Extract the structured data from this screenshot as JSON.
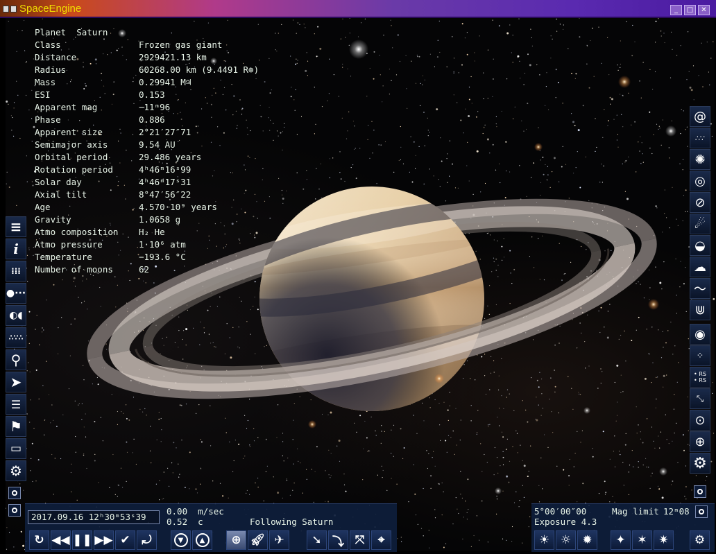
{
  "window": {
    "title": "SpaceEngine",
    "minimize_label": "_",
    "maximize_label": "□",
    "close_label": "✕"
  },
  "info": {
    "header_key": "Planet",
    "header_value": "Saturn",
    "rows": [
      {
        "key": "Class",
        "value": "Frozen gas giant"
      },
      {
        "key": "Distance",
        "value": "2929421.13 km"
      },
      {
        "key": "Radius",
        "value": "60268.00 km (9.4491 R⊕)"
      },
      {
        "key": "Mass",
        "value": "0.29941 M♃"
      },
      {
        "key": "ESI",
        "value": "0.153"
      },
      {
        "key": "Apparent mag",
        "value": "−11ᵐ96"
      },
      {
        "key": "Phase",
        "value": "0.886"
      },
      {
        "key": "Apparent size",
        "value": "2°21′27″71"
      },
      {
        "key": "Semimajor axis",
        "value": "9.54 AU"
      },
      {
        "key": "Orbital period",
        "value": "29.486 years"
      },
      {
        "key": "Rotation period",
        "value": "4ʰ46ᵐ16ˢ99"
      },
      {
        "key": "Solar day",
        "value": "4ʰ46ᵐ17ˢ31"
      },
      {
        "key": "Axial tilt",
        "value": "8°47′56″22"
      },
      {
        "key": "Age",
        "value": "4.570·10⁹ years"
      },
      {
        "key": "Gravity",
        "value": "1.0658 g"
      },
      {
        "key": "Atmo composition",
        "value": "H₂ He"
      },
      {
        "key": "Atmo pressure",
        "value": "1·10⁶ atm"
      },
      {
        "key": "Temperature",
        "value": "−193.6 °C"
      },
      {
        "key": "Number of moons",
        "value": "62"
      }
    ]
  },
  "bottom": {
    "date_time": "2017.09.16 12ʰ30ᵐ53ˢ39",
    "velocity": "0.00  m/sec",
    "velocity_c": "0.52  c",
    "following": "Following Saturn",
    "fov": "5°00′00″00",
    "exposure": "Exposure 4.3",
    "mag_limit_label": "Mag limit",
    "mag_limit_value": "12ᵐ08"
  },
  "colors": {
    "text": "#e8f4e8",
    "panel": "#0e1e3c",
    "title_text": "#f0e000"
  },
  "icons": {
    "left_toolbar": [
      "menu-icon",
      "info-icon",
      "clock-icon",
      "planet-orbits-icon",
      "two-bodies-icon",
      "stars-icon",
      "search-icon",
      "spaceship-icon",
      "list-icon",
      "flag-icon",
      "display-icon",
      "gear-icon"
    ],
    "right_toolbar": [
      "galaxy-icon",
      "star-cluster-icon",
      "globular-cluster-icon",
      "nebula-icon",
      "planet-ring-icon",
      "comet-icon",
      "cloud-layer-icon",
      "cumulus-icon",
      "wave-icon",
      "aurora-icon",
      "eye-orbit-icon",
      "sparkle-icon",
      "label-rs-icon",
      "arrows-in-icon",
      "circle-target-icon",
      "grid-globe-icon",
      "gear-icon"
    ]
  }
}
